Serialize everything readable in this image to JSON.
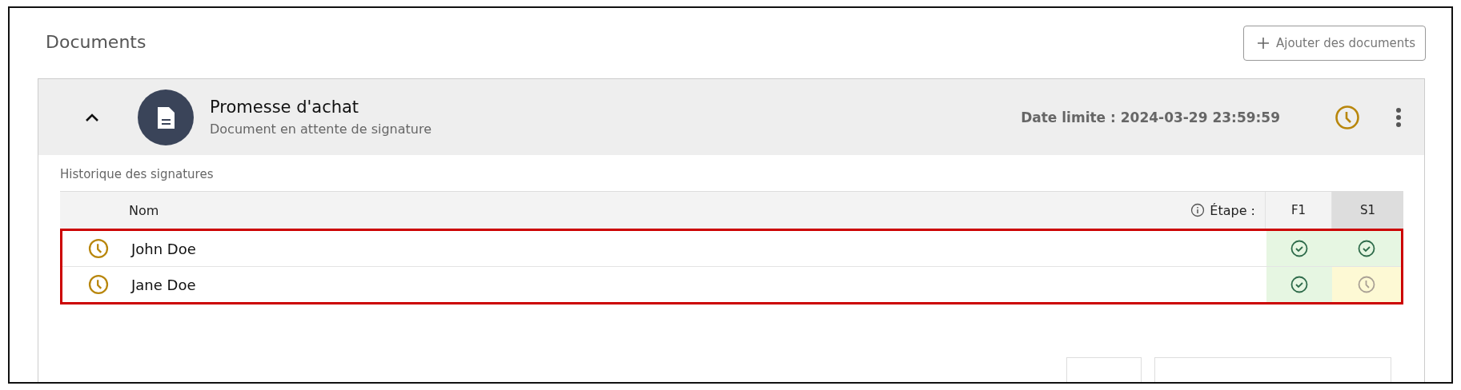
{
  "section": {
    "title": "Documents"
  },
  "add_button": {
    "label": "Ajouter des documents"
  },
  "document": {
    "expanded": true,
    "title": "Promesse d'achat",
    "subtitle": "Document en attente de signature",
    "deadline": "Date limite : 2024-03-29 23:59:59",
    "status": {
      "kind": "pending"
    }
  },
  "history": {
    "title": "Historique des signatures",
    "highlighted": true,
    "columns": {
      "name": "Nom",
      "step": "Étape :"
    },
    "steps": [
      {
        "label": "F1",
        "selected": false
      },
      {
        "label": "S1",
        "selected": true
      }
    ],
    "rows": [
      {
        "name": "John Doe",
        "status": {
          "kind": "pending"
        },
        "steps": [
          {
            "kind": "signed"
          },
          {
            "kind": "signed"
          }
        ]
      },
      {
        "name": "Jane Doe",
        "status": {
          "kind": "pending"
        },
        "steps": [
          {
            "kind": "signed"
          },
          {
            "kind": "pending"
          }
        ]
      }
    ]
  }
}
